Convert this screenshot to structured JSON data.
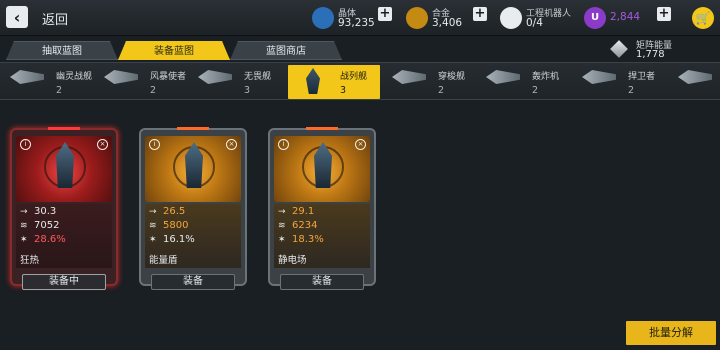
{
  "header": {
    "back_label": "返回",
    "resources": [
      {
        "name": "晶体",
        "value": "93,235",
        "icon": "crystal-icon",
        "color": "#3a8fd8"
      },
      {
        "name": "合金",
        "value": "3,406",
        "icon": "alloy-icon",
        "color": "#f2a21a"
      },
      {
        "name": "工程机器人",
        "value": "0/4",
        "icon": "robot-icon",
        "color": "#d0d5d8"
      },
      {
        "name": "",
        "value": "2,844",
        "icon": "u-coin-icon",
        "color": "#9a4bd6"
      }
    ],
    "cart_icon": "cart-icon"
  },
  "tabs": [
    {
      "label": "抽取蓝图",
      "active": false
    },
    {
      "label": "装备蓝图",
      "active": true
    },
    {
      "label": "蓝图商店",
      "active": false
    }
  ],
  "matrix_energy": {
    "name": "矩阵能量",
    "value": "1,778"
  },
  "ship_types": [
    {
      "label": "幽灵战舰",
      "count": "2"
    },
    {
      "label": "风暴使者",
      "count": "2"
    },
    {
      "label": "无畏舰",
      "count": "3"
    },
    {
      "label": "战列舰",
      "count": "3"
    },
    {
      "label": "穿梭舰",
      "count": "2"
    },
    {
      "label": "轰炸机",
      "count": "2"
    },
    {
      "label": "捍卫者",
      "count": "2"
    }
  ],
  "cards": [
    {
      "speed": "30.3",
      "armor": "7052",
      "bonus": "28.6%",
      "trait": "狂热",
      "button": "装备中",
      "variant": "red"
    },
    {
      "speed": "26.5",
      "armor": "5800",
      "bonus": "16.1%",
      "trait": "能量盾",
      "button": "装备",
      "variant": "gold"
    },
    {
      "speed": "29.1",
      "armor": "6234",
      "bonus": "18.3%",
      "trait": "静电场",
      "button": "装备",
      "variant": "gold"
    }
  ],
  "card_icons": {
    "info": "i",
    "close": "×",
    "speed": "→",
    "armor": "≋",
    "bonus": "✶"
  },
  "bulk_button": "批量分解"
}
